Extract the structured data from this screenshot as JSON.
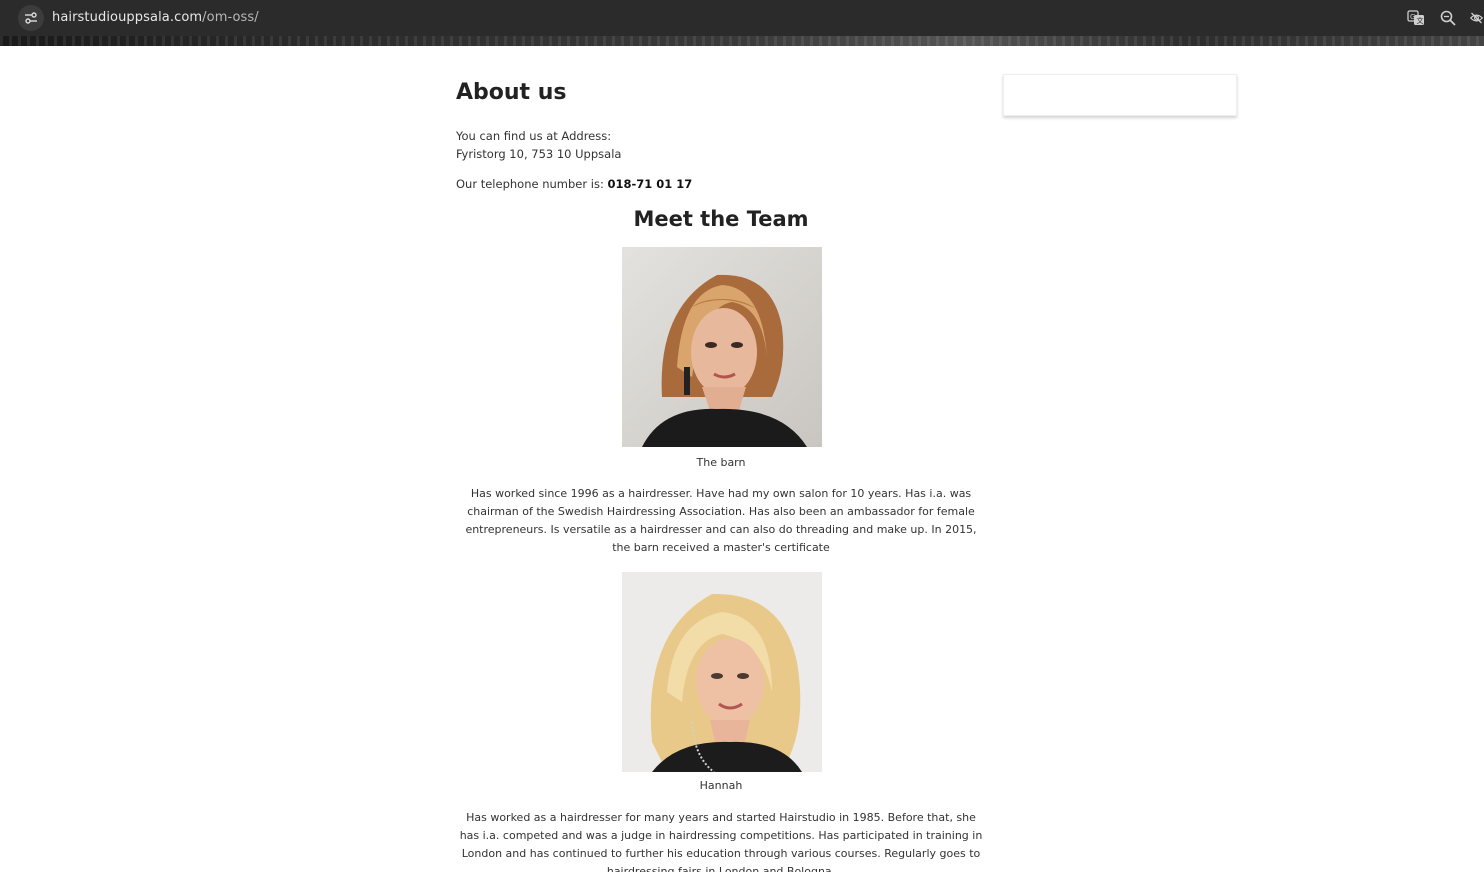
{
  "browser": {
    "url_domain": "hairstudiouppsala.com",
    "url_path": "/om-oss/",
    "icons": [
      "site-info-icon",
      "translate-icon",
      "zoom-icon",
      "eye-off-icon"
    ]
  },
  "page": {
    "title": "About us",
    "address_label": "You can find us at Address:",
    "address_value": "Fyristorg 10, 753 10 Uppsala",
    "phone_label": "Our telephone number is:",
    "phone_value": "018-71 01 17",
    "team_title": "Meet the Team"
  },
  "team": [
    {
      "name": "The barn",
      "bio": "Has worked since 1996 as a hairdresser. Have had my own salon for 10 years. Has i.a. was chairman of the Swedish Hairdressing Association. Has also been an ambassador for female entrepreneurs. Is versatile as a hairdresser and can also do threading and make up. In 2015, the barn received a master's certificate"
    },
    {
      "name": "Hannah",
      "bio": "Has worked as a hairdresser for many years and started Hairstudio in 1985. Before that, she has i.a. competed and was a judge in hairdressing competitions. Has participated in training in London and has continued to further his education through various courses. Regularly goes to hairdressing fairs in London and Bologna."
    }
  ]
}
